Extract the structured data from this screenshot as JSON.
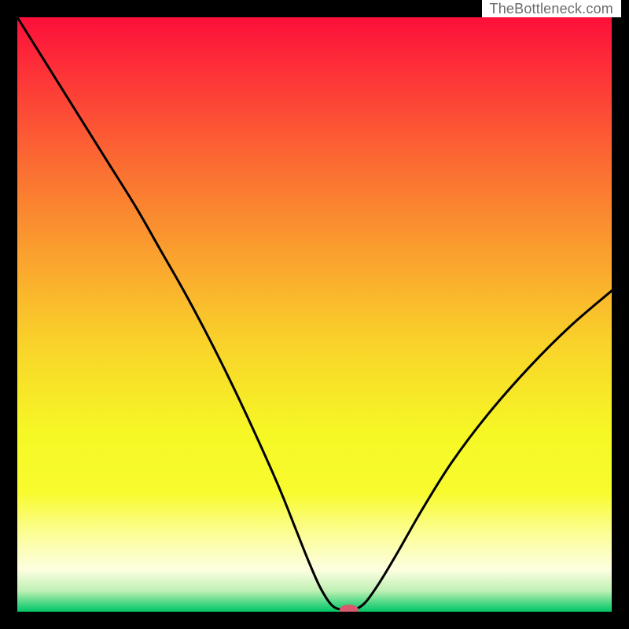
{
  "attribution": "TheBottleneck.com",
  "chart_data": {
    "type": "line",
    "title": "",
    "xlabel": "",
    "ylabel": "",
    "xlim": [
      0,
      100
    ],
    "ylim": [
      0,
      100
    ],
    "grid": false,
    "legend": false,
    "background_gradient": {
      "stops": [
        {
          "t": 0.0,
          "color": "#fd0f3a"
        },
        {
          "t": 0.1,
          "color": "#fd3538"
        },
        {
          "t": 0.25,
          "color": "#fb6d32"
        },
        {
          "t": 0.4,
          "color": "#faa12e"
        },
        {
          "t": 0.55,
          "color": "#f9d32a"
        },
        {
          "t": 0.7,
          "color": "#f6f825"
        },
        {
          "t": 0.8,
          "color": "#f8fb2e"
        },
        {
          "t": 0.88,
          "color": "#fcfea6"
        },
        {
          "t": 0.93,
          "color": "#fcfee0"
        },
        {
          "t": 0.965,
          "color": "#bff0b4"
        },
        {
          "t": 0.985,
          "color": "#4bd885"
        },
        {
          "t": 1.0,
          "color": "#00c667"
        }
      ]
    },
    "series": [
      {
        "name": "bottleneck-curve",
        "stroke": "#000000",
        "stroke_width": 3,
        "x": [
          0.0,
          5.0,
          10.0,
          15.0,
          20.0,
          24.0,
          28.0,
          32.0,
          36.0,
          40.0,
          44.0,
          47.0,
          49.0,
          51.0,
          53.0,
          55.0,
          56.5,
          58.5,
          61.0,
          64.0,
          68.0,
          73.0,
          79.0,
          86.0,
          93.0,
          100.0
        ],
        "y": [
          100.0,
          92.0,
          84.0,
          76.0,
          68.0,
          61.0,
          54.0,
          46.5,
          38.5,
          30.0,
          21.0,
          13.5,
          8.5,
          4.0,
          1.0,
          0.3,
          0.3,
          1.5,
          5.0,
          10.0,
          17.0,
          25.0,
          33.0,
          41.0,
          48.0,
          54.0
        ]
      }
    ],
    "marker": {
      "name": "sweet-spot-marker",
      "x": 55.8,
      "y": 0.3,
      "rx": 1.6,
      "ry": 0.9,
      "fill": "#d9596e"
    }
  }
}
